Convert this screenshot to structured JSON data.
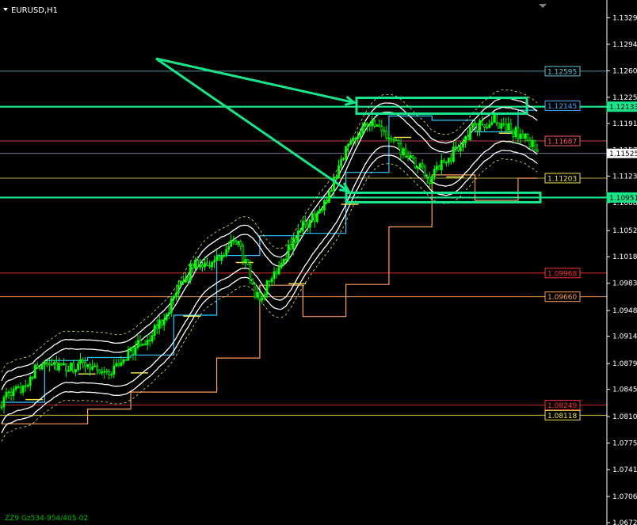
{
  "window": {
    "title": "EURUSD,H1",
    "footer": "ZZ9 Gz534-954/405-02"
  },
  "chart_data": {
    "type": "candlestick",
    "symbol": "EURUSD",
    "timeframe": "H1",
    "grid": false,
    "ylim": [
      1.0672,
      1.1348
    ],
    "y_ticks": [
      "1.13290",
      "1.12945",
      "1.12600",
      "1.12255",
      "1.11915",
      "1.11570",
      "1.11230",
      "1.10885",
      "1.10520",
      "1.10180",
      "1.09835",
      "1.09480",
      "1.09145",
      "1.08790",
      "1.08455",
      "1.08100",
      "1.07755",
      "1.07410",
      "1.07060",
      "1.06720"
    ],
    "current_price": "1.11525",
    "price_path": [
      1.083,
      1.085,
      1.0885,
      1.087,
      1.088,
      1.0865,
      1.0895,
      1.0915,
      1.096,
      1.101,
      1.101,
      1.104,
      1.096,
      1.101,
      1.1055,
      1.108,
      1.1155,
      1.1195,
      1.1175,
      1.1145,
      1.112,
      1.115,
      1.1185,
      1.1195,
      1.118,
      1.116
    ],
    "levels": [
      {
        "label": "1.12595",
        "value": 1.12595,
        "color": "#5fc4d8",
        "style": "solid-thin"
      },
      {
        "label": "1.12145",
        "value": 1.12145,
        "color": "#4aa8ff",
        "style": "box"
      },
      {
        "label": "1.12133",
        "value": 1.12133,
        "color": "#19e68a",
        "style": "thick-green"
      },
      {
        "label": "1.11687",
        "value": 1.11687,
        "color": "#ff5a5a",
        "style": "solid-thin"
      },
      {
        "label": "1.11203",
        "value": 1.11203,
        "color": "#f0e050",
        "style": "solid-thin"
      },
      {
        "label": "1.10951",
        "value": 1.10951,
        "color": "#19e68a",
        "style": "thick-green"
      },
      {
        "label": "1.09968",
        "value": 1.09968,
        "color": "#ff3030",
        "style": "solid-thin"
      },
      {
        "label": "1.09660",
        "value": 1.0966,
        "color": "#ffa050",
        "style": "solid-thin"
      },
      {
        "label": "1.08249",
        "value": 1.08249,
        "color": "#ff3030",
        "style": "solid-thin"
      },
      {
        "label": "1.08118",
        "value": 1.08118,
        "color": "#f0e050",
        "style": "solid-thin"
      }
    ],
    "colors": {
      "background": "#000000",
      "candle": "#00ff00",
      "band": "#ffffff",
      "support_steps": "#ffa060",
      "resistance_steps": "#30c8ff",
      "annotation": "#19e68a",
      "current_price_line": "#a0a0c0",
      "text": "#ffffff"
    }
  }
}
